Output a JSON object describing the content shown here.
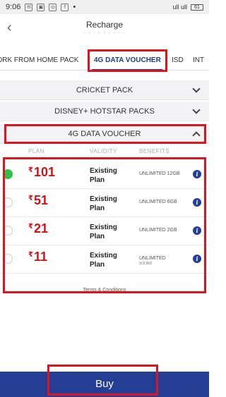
{
  "status_bar": {
    "time": "9:06",
    "left_icons": [
      "sms-icon",
      "photo-icon",
      "whatsapp-icon",
      "facebook-icon"
    ],
    "right_text": "ull ull",
    "battery": "61"
  },
  "header": {
    "title": "Recharge",
    "subtitle": "· · · · · · · · ·"
  },
  "tabs": [
    {
      "label": "WORK FROM HOME PACK",
      "active": false
    },
    {
      "label": "4G DATA VOUCHER",
      "active": true
    },
    {
      "label": "ISD",
      "active": false
    },
    {
      "label": "INT",
      "active": false
    }
  ],
  "sections": [
    {
      "title": "CRICKET PACK",
      "expanded": false
    },
    {
      "title": "DISNEY+ HOTSTAR PACKS",
      "expanded": false
    },
    {
      "title": "4G DATA VOUCHER",
      "expanded": true
    }
  ],
  "table": {
    "columns": [
      "PLAN",
      "VALIDITY",
      "BENEFITS"
    ],
    "currency": "₹",
    "rows": [
      {
        "price": "101",
        "validity": "Existing Plan",
        "benefit": "UNLIMITED 12GB",
        "benefit_sub": "",
        "selected": true
      },
      {
        "price": "51",
        "validity": "Existing Plan",
        "benefit": "UNLIMITED 6GB",
        "benefit_sub": "",
        "selected": false
      },
      {
        "price": "21",
        "validity": "Existing Plan",
        "benefit": "UNLIMITED 2GB",
        "benefit_sub": "",
        "selected": false
      },
      {
        "price": "11",
        "validity": "Existing Plan",
        "benefit": "UNLIMITED",
        "benefit_sub": "SOUND",
        "selected": false
      }
    ]
  },
  "terms_label": "Terms & Conditions",
  "buy_label": "Buy",
  "colors": {
    "accent": "#1a3e8a",
    "buy_bar": "#243e96",
    "price": "#d0121b",
    "selected_radio": "#2fbf4a",
    "highlight": "#e0141e"
  }
}
